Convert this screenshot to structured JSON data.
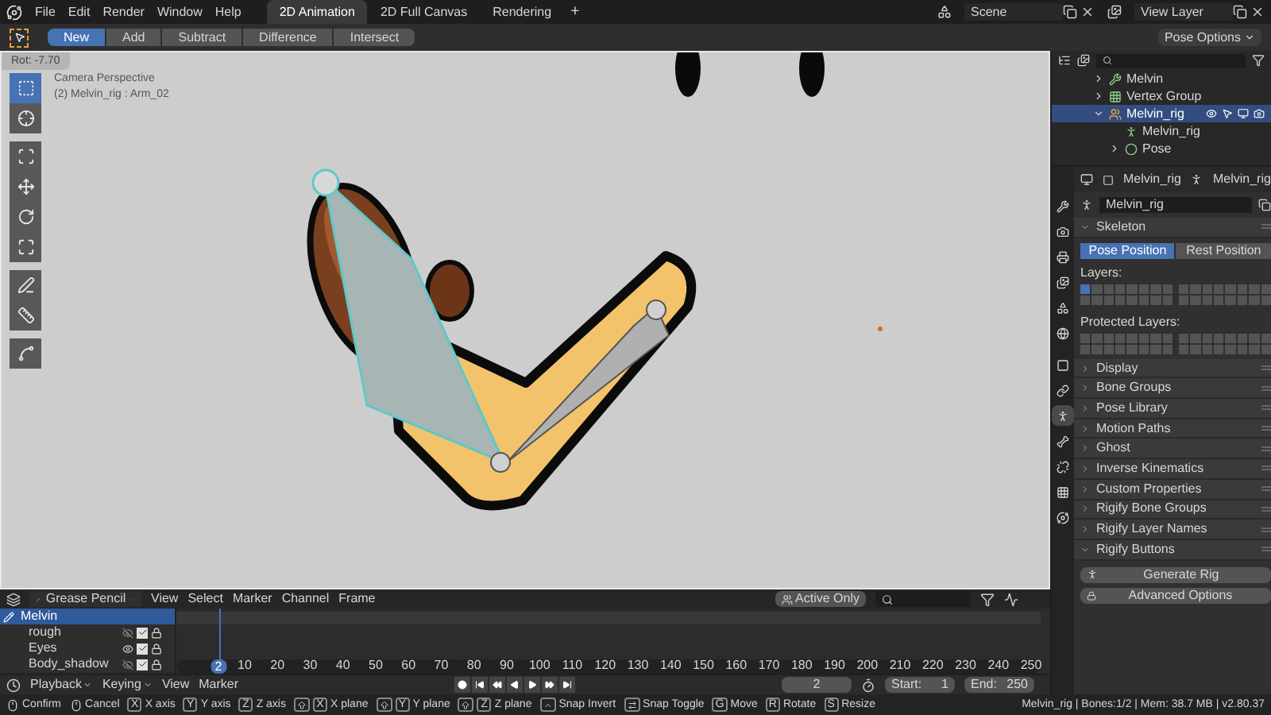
{
  "top_bar": {
    "menus": [
      "File",
      "Edit",
      "Render",
      "Window",
      "Help"
    ],
    "workspace_tabs": [
      {
        "label": "2D Animation",
        "selected": true
      },
      {
        "label": "2D Full Canvas",
        "selected": false
      },
      {
        "label": "Rendering",
        "selected": false
      }
    ],
    "add_tab": "+",
    "scene": "Scene",
    "view_layer": "View Layer"
  },
  "tool_header": {
    "modes": [
      {
        "label": "New",
        "selected": true
      },
      {
        "label": "Add",
        "selected": false
      },
      {
        "label": "Subtract",
        "selected": false
      },
      {
        "label": "Difference",
        "selected": false
      },
      {
        "label": "Intersect",
        "selected": false
      }
    ],
    "pose_options": "Pose Options"
  },
  "viewport": {
    "rotation": "Rot: -7.70",
    "view_name": "Camera Perspective",
    "object_info": "(2) Melvin_rig : Arm_02",
    "tools": [
      {
        "kind": "select_box",
        "selected": true
      },
      {
        "kind": "cursor",
        "selected": false
      },
      {
        "kind": "transform",
        "selected": false
      },
      {
        "kind": "move",
        "selected": false
      },
      {
        "kind": "rotate",
        "selected": false
      },
      {
        "kind": "scale",
        "selected": false
      },
      {
        "kind": "annotate",
        "selected": false
      },
      {
        "kind": "measure",
        "selected": false
      },
      {
        "kind": "bend",
        "selected": false
      }
    ]
  },
  "outliner": {
    "rows": [
      {
        "label": "Melvin",
        "kind": "modifier",
        "expanded": false,
        "selected": false
      },
      {
        "label": "Vertex Group",
        "kind": "vertex_group",
        "expanded": false,
        "selected": false
      },
      {
        "label": "Melvin_rig",
        "kind": "armature_object",
        "expanded": true,
        "selected": true,
        "children": [
          {
            "label": "Melvin_rig",
            "kind": "armature_data",
            "selected": false
          },
          {
            "label": "Pose",
            "kind": "pose",
            "expanded": false,
            "selected": false
          }
        ]
      }
    ]
  },
  "properties": {
    "tabs": [
      {
        "kind": "tool",
        "selected": false
      },
      {
        "kind": "render",
        "selected": false
      },
      {
        "kind": "output",
        "selected": false
      },
      {
        "kind": "view_layer",
        "selected": false
      },
      {
        "kind": "scene",
        "selected": false
      },
      {
        "kind": "world",
        "selected": false
      },
      {
        "kind": "object",
        "selected": false
      },
      {
        "kind": "constraints",
        "selected": false
      },
      {
        "kind": "data",
        "selected": true
      },
      {
        "kind": "bone",
        "selected": false
      },
      {
        "kind": "bone_constraint",
        "selected": false
      },
      {
        "kind": "texture",
        "selected": false
      },
      {
        "kind": "physics",
        "selected": false
      }
    ],
    "breadcrumb": [
      "Melvin_rig",
      "Melvin_rig"
    ],
    "name": "Melvin_rig",
    "skeleton": {
      "label": "Skeleton",
      "expanded": true,
      "positions": [
        {
          "label": "Pose Position",
          "selected": true
        },
        {
          "label": "Rest Position",
          "selected": false
        }
      ],
      "layers_label": "Layers:",
      "layers": [
        {
          "selected": true
        },
        {
          "selected": false
        },
        {
          "selected": false
        },
        {
          "selected": false
        },
        {
          "selected": false
        },
        {
          "selected": false
        },
        {
          "selected": false
        },
        {
          "selected": false
        },
        {
          "selected": false
        },
        {
          "selected": false
        },
        {
          "selected": false
        },
        {
          "selected": false
        },
        {
          "selected": false
        },
        {
          "selected": false
        },
        {
          "selected": false
        },
        {
          "selected": false
        },
        {
          "selected": false
        },
        {
          "selected": false
        },
        {
          "selected": false
        },
        {
          "selected": false
        },
        {
          "selected": false
        },
        {
          "selected": false
        },
        {
          "selected": false
        },
        {
          "selected": false
        },
        {
          "selected": false
        },
        {
          "selected": false
        },
        {
          "selected": false
        },
        {
          "selected": false
        },
        {
          "selected": false
        },
        {
          "selected": false
        },
        {
          "selected": false
        },
        {
          "selected": false
        }
      ],
      "protected_label": "Protected Layers:",
      "protected_layers": [
        {
          "selected": false
        },
        {
          "selected": false
        },
        {
          "selected": false
        },
        {
          "selected": false
        },
        {
          "selected": false
        },
        {
          "selected": false
        },
        {
          "selected": false
        },
        {
          "selected": false
        },
        {
          "selected": false
        },
        {
          "selected": false
        },
        {
          "selected": false
        },
        {
          "selected": false
        },
        {
          "selected": false
        },
        {
          "selected": false
        },
        {
          "selected": false
        },
        {
          "selected": false
        },
        {
          "selected": false
        },
        {
          "selected": false
        },
        {
          "selected": false
        },
        {
          "selected": false
        },
        {
          "selected": false
        },
        {
          "selected": false
        },
        {
          "selected": false
        },
        {
          "selected": false
        },
        {
          "selected": false
        },
        {
          "selected": false
        },
        {
          "selected": false
        },
        {
          "selected": false
        },
        {
          "selected": false
        },
        {
          "selected": false
        },
        {
          "selected": false
        },
        {
          "selected": false
        }
      ]
    },
    "panels": [
      {
        "label": "Display",
        "expanded": false
      },
      {
        "label": "Bone Groups",
        "expanded": false
      },
      {
        "label": "Pose Library",
        "expanded": false
      },
      {
        "label": "Motion Paths",
        "expanded": false
      },
      {
        "label": "Ghost",
        "expanded": false
      },
      {
        "label": "Inverse Kinematics",
        "expanded": false
      },
      {
        "label": "Custom Properties",
        "expanded": false
      },
      {
        "label": "Rigify Bone Groups",
        "expanded": false
      },
      {
        "label": "Rigify Layer Names",
        "expanded": false
      }
    ],
    "rigify_buttons": {
      "label": "Rigify Buttons",
      "expanded": true,
      "buttons": [
        {
          "label": "Generate Rig",
          "kind": "generate"
        },
        {
          "label": "Advanced Options",
          "kind": "lock"
        }
      ]
    }
  },
  "timeline": {
    "mode": "Grease Pencil",
    "menus": [
      "View",
      "Select",
      "Marker",
      "Channel",
      "Frame"
    ],
    "active_only": "Active Only",
    "channels": [
      {
        "label": "Melvin",
        "kind": "object",
        "selected": true
      },
      {
        "label": "rough",
        "kind": "layer",
        "selected": false,
        "visible": false,
        "checked": true,
        "locked": true
      },
      {
        "label": "Eyes",
        "kind": "layer",
        "selected": false,
        "visible": true,
        "checked": true,
        "locked": true
      },
      {
        "label": "Body_shadow",
        "kind": "layer",
        "selected": false,
        "visible": false,
        "checked": true,
        "locked": true
      }
    ],
    "current_frame": "2",
    "ticks": [
      "10",
      "20",
      "30",
      "40",
      "50",
      "60",
      "70",
      "80",
      "90",
      "100",
      "110",
      "120",
      "130",
      "140",
      "150",
      "160",
      "170",
      "180",
      "190",
      "200",
      "210",
      "220",
      "230",
      "240",
      "250"
    ]
  },
  "playback": {
    "menus": [
      "Playback",
      "Keying"
    ],
    "plain_menus": [
      "View",
      "Marker"
    ],
    "frame": "2",
    "start_label": "Start:",
    "start": "1",
    "end_label": "End:",
    "end": "250"
  },
  "status_bar": {
    "hints": [
      {
        "keys": [
          {
            "kind": "mouse_left"
          }
        ],
        "label": "Confirm"
      },
      {
        "keys": [
          {
            "kind": "mouse_right"
          }
        ],
        "label": "Cancel"
      },
      {
        "keys": [
          {
            "kind": "letter",
            "label": "X"
          }
        ],
        "label": "X axis"
      },
      {
        "keys": [
          {
            "kind": "letter",
            "label": "Y"
          }
        ],
        "label": "Y axis"
      },
      {
        "keys": [
          {
            "kind": "letter",
            "label": "Z"
          }
        ],
        "label": "Z axis"
      },
      {
        "keys": [
          {
            "kind": "shift"
          },
          {
            "kind": "letter",
            "label": "X"
          }
        ],
        "label": "X plane"
      },
      {
        "keys": [
          {
            "kind": "shift"
          },
          {
            "kind": "letter",
            "label": "Y"
          }
        ],
        "label": "Y plane"
      },
      {
        "keys": [
          {
            "kind": "shift"
          },
          {
            "kind": "letter",
            "label": "Z"
          }
        ],
        "label": "Z plane"
      },
      {
        "keys": [
          {
            "kind": "ctrl"
          }
        ],
        "label": "Snap Invert"
      },
      {
        "keys": [
          {
            "kind": "tab"
          }
        ],
        "label": "Snap Toggle"
      },
      {
        "keys": [
          {
            "kind": "letter",
            "label": "G"
          }
        ],
        "label": "Move"
      },
      {
        "keys": [
          {
            "kind": "letter",
            "label": "R"
          }
        ],
        "label": "Rotate"
      },
      {
        "keys": [
          {
            "kind": "letter",
            "label": "S"
          }
        ],
        "label": "Resize"
      }
    ],
    "info": "Melvin_rig | Bones:1/2 | Mem: 38.7 MB | v2.80.37"
  }
}
